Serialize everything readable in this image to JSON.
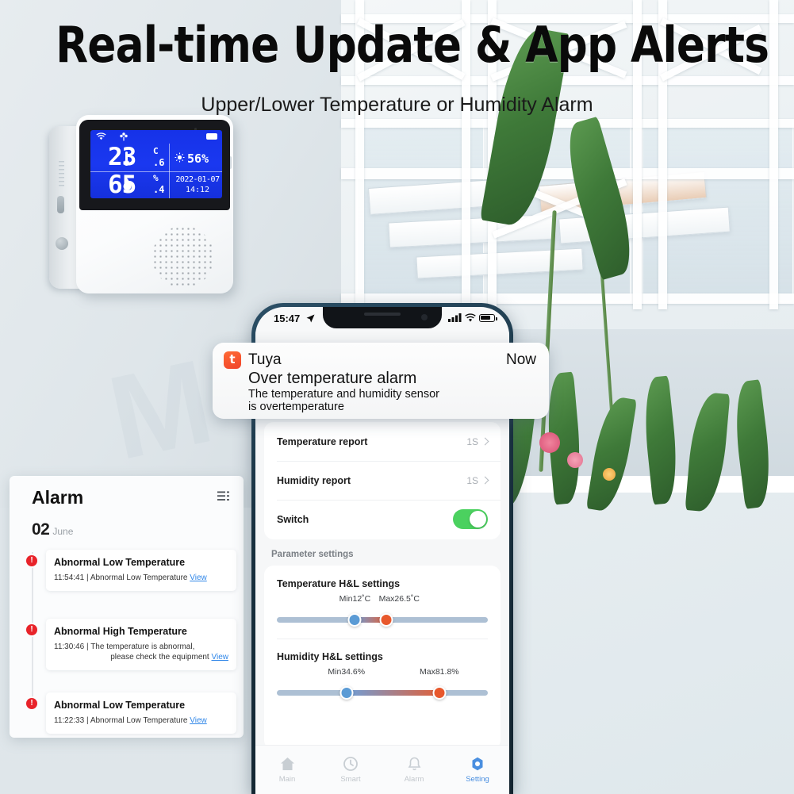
{
  "headline": {
    "title": "Real-time Update & App Alerts",
    "subtitle": "Upper/Lower Temperature or Humidity Alarm"
  },
  "device": {
    "lcd": {
      "wifi_icon": "wifi-icon",
      "flower_icon": "flower-icon",
      "battery_icon": "battery-icon",
      "thermometer_icon": "thermometer-icon",
      "droplet_icon": "droplet-icon",
      "brightness_icon": "sun-icon",
      "temperature_value": "23",
      "temperature_unit": "C",
      "temperature_decimal": ".6",
      "brightness_value": "56%",
      "humidity_value": "65",
      "humidity_unit": "%",
      "humidity_decimal": ".4",
      "date": "2022-01-07",
      "time": "14:12"
    }
  },
  "alarm_panel": {
    "title": "Alarm",
    "menu_icon": "list-menu-icon",
    "date_day": "02",
    "date_month": "June",
    "items": [
      {
        "badge": "!",
        "title": "Abnormal Low Temperature",
        "time": "11:54:41",
        "separator": "|",
        "message": "Abnormal Low Temperature",
        "message_line2": "",
        "view_label": "View"
      },
      {
        "badge": "!",
        "title": "Abnormal High Temperature",
        "time": "11:30:46",
        "separator": "|",
        "message": "The temperature is abnormal,",
        "message_line2": "please check the equipment",
        "view_label": "View"
      },
      {
        "badge": "!",
        "title": "Abnormal Low Temperature",
        "time": "11:22:33",
        "separator": "|",
        "message": "Abnormal Low Temperature",
        "message_line2": "",
        "view_label": "View"
      }
    ]
  },
  "phone": {
    "statusbar": {
      "time": "15:47",
      "location_icon": "location-arrow-icon",
      "signal_icon": "signal-bars-icon",
      "wifi_icon": "wifi-icon",
      "battery_icon": "battery-icon"
    },
    "settings_rows": [
      {
        "label": "Temperature report",
        "value": "1S",
        "chevron_icon": "chevron-right-icon"
      },
      {
        "label": "Humidity report",
        "value": "1S",
        "chevron_icon": "chevron-right-icon"
      },
      {
        "label": "Switch",
        "toggle_on": true
      }
    ],
    "section_label": "Parameter settings",
    "sliders": [
      {
        "title": "Temperature H&L settings",
        "min_label": "Min12˚C",
        "max_label": "Max26.5˚C",
        "min_pct": 37,
        "max_pct": 52
      },
      {
        "title": "Humidity H&L settings",
        "min_label": "Min34.6%",
        "max_label": "Max81.8%",
        "min_pct": 33,
        "max_pct": 77
      }
    ],
    "tabs": [
      {
        "label": "Main",
        "icon": "home-icon",
        "active": false
      },
      {
        "label": "Smart",
        "icon": "clock-icon",
        "active": false
      },
      {
        "label": "Alarm",
        "icon": "bell-icon",
        "active": false
      },
      {
        "label": "Setting",
        "icon": "gear-icon",
        "active": true
      }
    ]
  },
  "notification": {
    "app_icon": "tuya-icon",
    "app_icon_glyph": "t",
    "app_name": "Tuya",
    "timestamp": "Now",
    "title": "Over temperature alarm",
    "body_line1": "The temperature and humidity sensor",
    "body_line2": "is overtemperature"
  },
  "colors": {
    "accent_blue": "#4a8fe0",
    "toggle_green": "#4bd15f",
    "alert_red": "#e8232a",
    "slider_min": "#5b9bd5",
    "slider_max": "#e8582c",
    "tuya_orange": "#f0432a",
    "lcd_blue": "#1a38f0"
  }
}
